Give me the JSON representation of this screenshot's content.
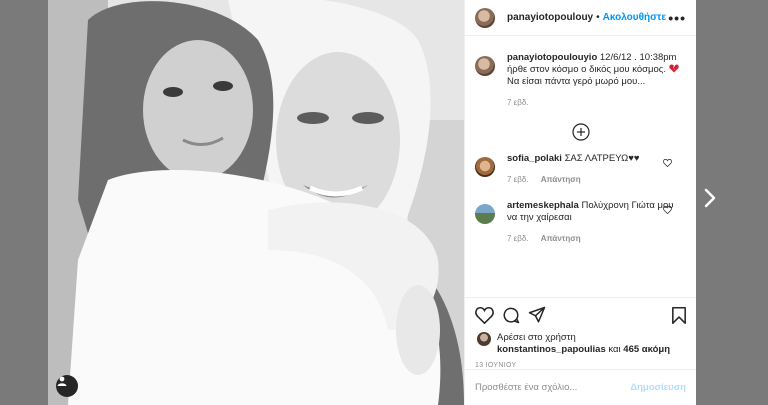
{
  "header": {
    "username": "panayiotopoulouy",
    "separator": "•",
    "follow_label": "Ακολουθήστε",
    "more": "•••"
  },
  "caption": {
    "username": "panayiotopoulouyio",
    "text": "12/6/12 . 10:38pm ήρθε στον κόσμο ο δικός μου κόσμος.",
    "text2": "Να είσαι πάντα γερό μωρό μου...",
    "time": "7 εβδ."
  },
  "comments": [
    {
      "username": "sofia_polaki",
      "text": "ΣΑΣ ΛΑΤΡΕΥΩ♥♥",
      "time": "7 εβδ.",
      "reply": "Απάντηση"
    },
    {
      "username": "artemeskephala",
      "text": "Πολύχρονη Γιώτα μου να την χαίρεσαι",
      "time": "7 εβδ.",
      "reply": "Απάντηση"
    }
  ],
  "likes": {
    "prefix": "Αρέσει στο χρήστη",
    "user": "konstantinos_papoulias",
    "and": "και",
    "count": "465 ακόμη"
  },
  "date": "13 ΙΟΥΝΙΟΥ",
  "add_comment": {
    "placeholder": "Προσθέστε ένα σχόλιο...",
    "post_label": "Δημοσίευση"
  },
  "icons": {
    "like": "heart-icon",
    "comment": "comment-icon",
    "share": "share-icon",
    "save": "bookmark-icon",
    "more_comments": "plus-circle-icon",
    "next": "chevron-right-icon"
  },
  "colors": {
    "accent": "#0095f6",
    "post_disabled": "#b2dffc",
    "broken_heart": "#d0233b"
  }
}
